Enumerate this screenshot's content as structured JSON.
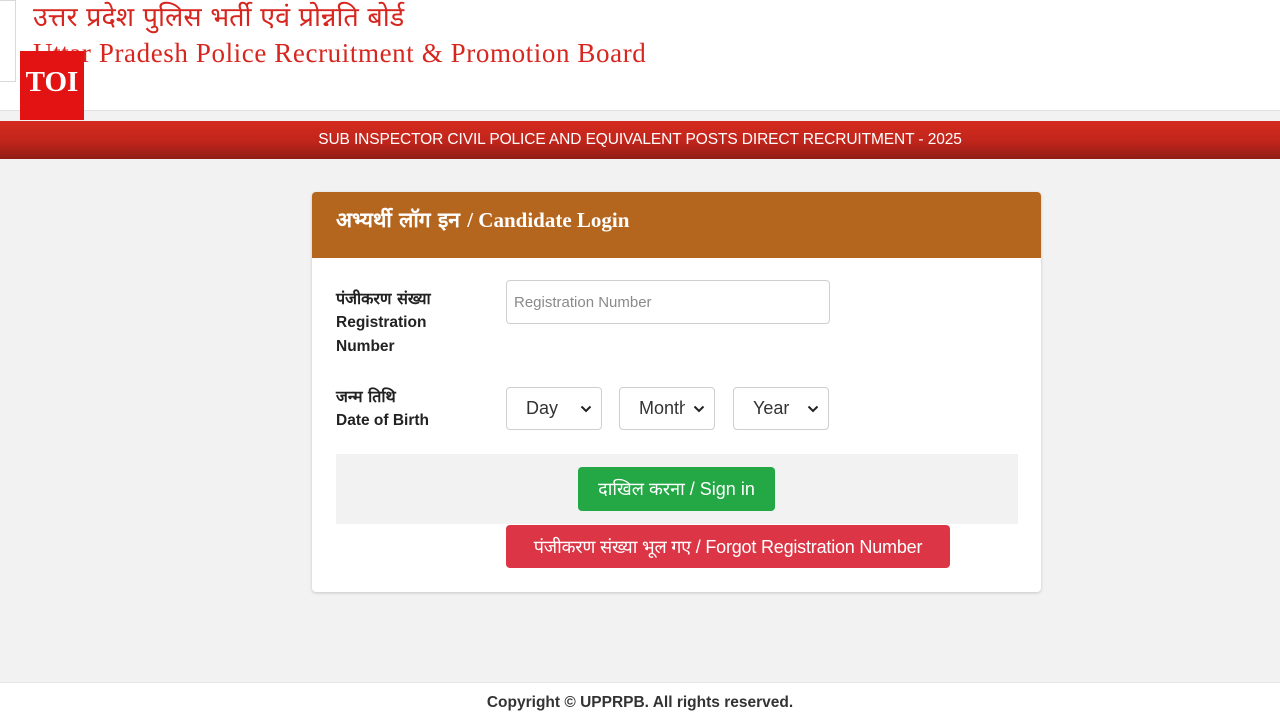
{
  "header": {
    "title_hindi": "उत्तर प्रदेश पुलिस भर्ती एवं प्रोन्नति बोर्ड",
    "title_english": "Uttar Pradesh Police Recruitment & Promotion Board",
    "badge": "TOI",
    "accent_color": "#d7261f"
  },
  "banner": {
    "text": "SUB INSPECTOR CIVIL POLICE AND EQUIVALENT POSTS DIRECT RECRUITMENT - 2025"
  },
  "login": {
    "title_hindi": "अभ्यर्थी लॉग इन",
    "title_sep": "/ Candidate Login",
    "header_color": "#b4661f",
    "registration": {
      "label_hindi": "पंजीकरण संख्या",
      "label_en_1": "Registration",
      "label_en_2": "Number",
      "value": "",
      "placeholder": "Registration Number"
    },
    "dob": {
      "label_hindi": "जन्म तिथि",
      "label_en": "Date of Birth",
      "day": "Day",
      "month": "Month",
      "year": "Year"
    },
    "signin_label": "दाखिल करना / Sign in",
    "forgot_label": "पंजीकरण संख्या भूल गए / Forgot Registration Number",
    "signin_color": "#24a745",
    "forgot_color": "#dc3545"
  },
  "footer": {
    "copyright": "Copyright © UPPRPB. All rights reserved."
  },
  "icons": {
    "select_arrow": "chevron-down-icon"
  }
}
